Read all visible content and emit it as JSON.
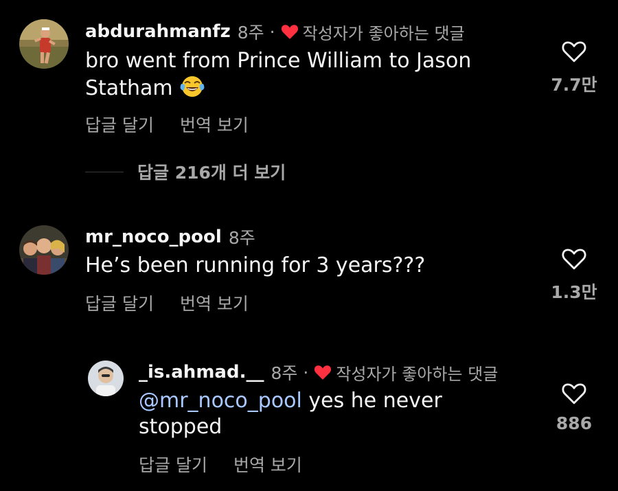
{
  "colors": {
    "background": "#000000",
    "text_primary": "#f5f5f5",
    "text_secondary": "#a8a8a8",
    "mention": "#a8c8ff",
    "creator_heart": "#ff3040"
  },
  "comments": [
    {
      "username": "abdurahmanfz",
      "time": "8주",
      "dot": "·",
      "creator_liked_label": "작성자가 좋아하는 댓글",
      "text_line1": "bro went from Prince William to Jason",
      "text_line2": "Statham",
      "emoji": "face-with-tears-of-joy",
      "reply_label": "답글 달기",
      "translate_label": "번역 보기",
      "like_count": "7.7만",
      "icon": "heart-outline-icon"
    },
    {
      "username": "mr_noco_pool",
      "time": "8주",
      "text_line1": "He’s been running for 3 years???",
      "reply_label": "답글 달기",
      "translate_label": "번역 보기",
      "like_count": "1.3만",
      "icon": "heart-outline-icon"
    },
    {
      "username": "_is.ahmad.__",
      "time": "8주",
      "dot": "·",
      "creator_liked_label": "작성자가 좋아하는 댓글",
      "mention": "@mr_noco_pool",
      "text_line1_rest": " yes he never",
      "text_line2": "stopped",
      "reply_label": "답글 달기",
      "translate_label": "번역 보기",
      "like_count": "886",
      "icon": "heart-outline-icon"
    }
  ],
  "view_replies_label": "답글 216개 더 보기"
}
